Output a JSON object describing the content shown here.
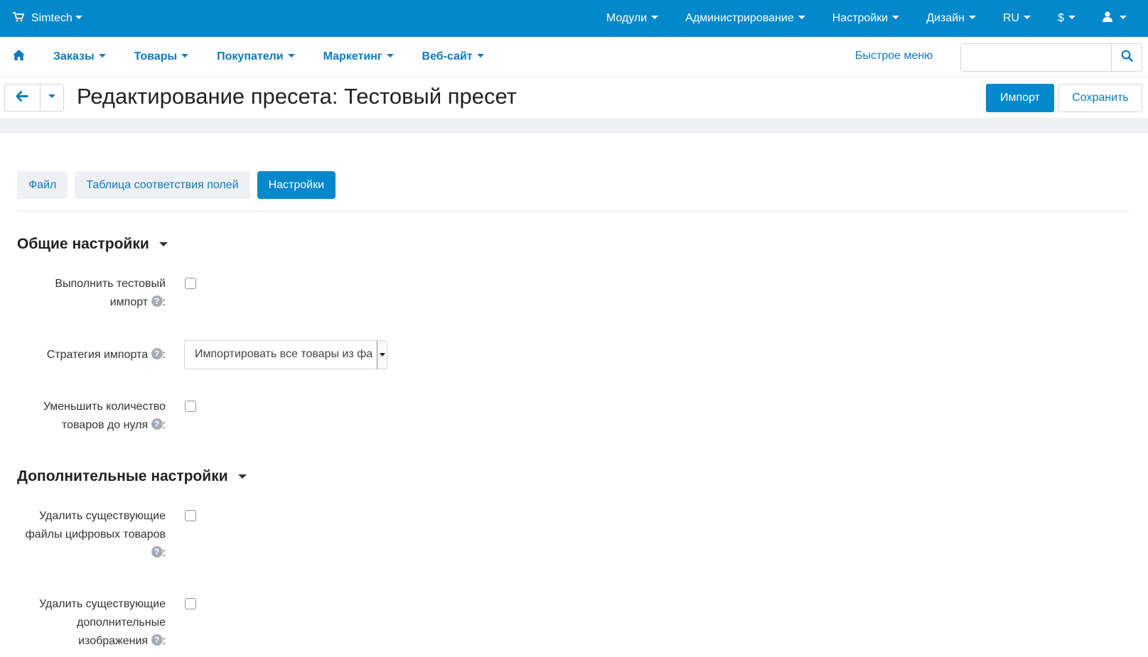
{
  "topbar": {
    "brand": "Simtech",
    "menu": [
      "Модули",
      "Администрирование",
      "Настройки",
      "Дизайн",
      "RU",
      "$"
    ]
  },
  "navbar": {
    "items": [
      "Заказы",
      "Товары",
      "Покупатели",
      "Маркетинг",
      "Веб-сайт"
    ],
    "quick_menu": "Быстрое меню",
    "search_placeholder": ""
  },
  "header": {
    "title": "Редактирование пресета: Тестовый пресет",
    "import_label": "Импорт",
    "save_label": "Сохранить"
  },
  "tabs": [
    {
      "label": "Файл",
      "active": false
    },
    {
      "label": "Таблица соответствия полей",
      "active": false
    },
    {
      "label": "Настройки",
      "active": true
    }
  ],
  "sections": {
    "general": {
      "title": "Общие настройки",
      "test_import_label": "Выполнить тестовый импорт",
      "test_import_checked": false,
      "strategy_label": "Стратегия импорта",
      "strategy_value": "Импортировать все товары из файла",
      "reduce_qty_label": "Уменьшить количество товаров до нуля",
      "reduce_qty_checked": false
    },
    "additional": {
      "title": "Дополнительные настройки",
      "delete_files_label": "Удалить существующие файлы цифровых товаров",
      "delete_files_checked": false,
      "delete_images_label": "Удалить существующие дополнительные изображения",
      "delete_images_checked": false
    }
  },
  "colors": {
    "primary": "#0388cc",
    "link": "#0a7bc0",
    "gray_bg": "#eef0f3"
  }
}
